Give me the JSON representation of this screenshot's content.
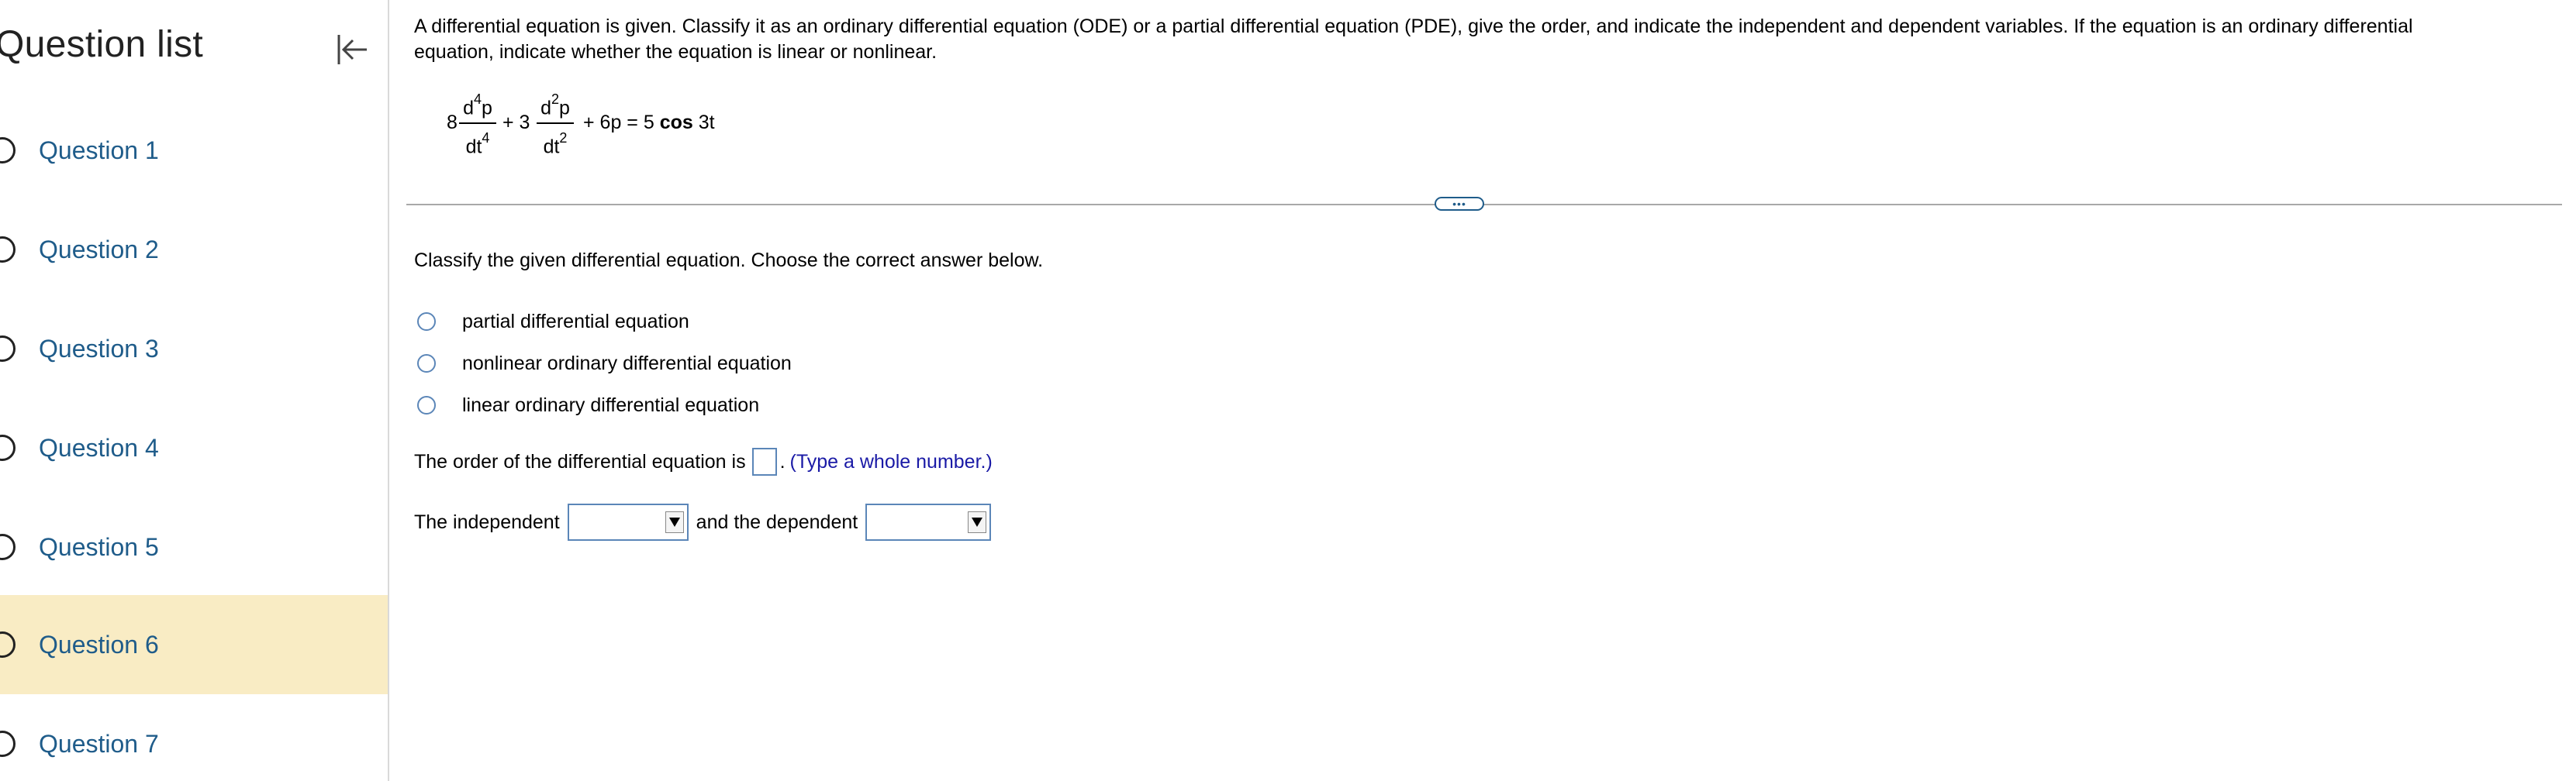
{
  "sidebar": {
    "title": "Question list",
    "items": [
      {
        "label": "Question 1"
      },
      {
        "label": "Question 2"
      },
      {
        "label": "Question 3"
      },
      {
        "label": "Question 4"
      },
      {
        "label": "Question 5"
      },
      {
        "label": "Question 6",
        "active": true
      },
      {
        "label": "Question 7"
      }
    ],
    "collapse_icon": "collapse-left-icon",
    "active_color": "#f9ecc4"
  },
  "question": {
    "prompt": "A differential equation is given. Classify it as an ordinary differential equation (ODE) or a partial differential equation (PDE), give the order, and indicate the independent and dependent variables. If the equation is an ordinary differential equation, indicate whether the equation is linear or nonlinear.",
    "equation": {
      "coef1": "8",
      "frac1_num": "d",
      "frac1_num_exp": "4",
      "frac1_num_var": "p",
      "frac1_den": "dt",
      "frac1_den_exp": "4",
      "plus1": "+ 3",
      "frac2_num": "d",
      "frac2_num_exp": "2",
      "frac2_num_var": "p",
      "frac2_den": "dt",
      "frac2_den_exp": "2",
      "rest_pre": "+ 6p = 5",
      "rest_cos": "cos",
      "rest_post": "3t"
    },
    "more_button": "•••",
    "classify_prompt": "Classify the given differential equation. Choose the correct answer below.",
    "options": [
      "partial differential equation",
      "nonlinear ordinary differential equation",
      "linear ordinary differential equation"
    ],
    "order_prompt": "The order of the differential equation is",
    "order_value": "",
    "order_suffix": ".",
    "order_hint": "(Type a whole number.)",
    "independent_label": "The independent",
    "independent_value": "",
    "dependent_label": "and the dependent",
    "dependent_value": "",
    "accent_color": "#1f5c8a",
    "hint_color": "#1a1aa6"
  }
}
